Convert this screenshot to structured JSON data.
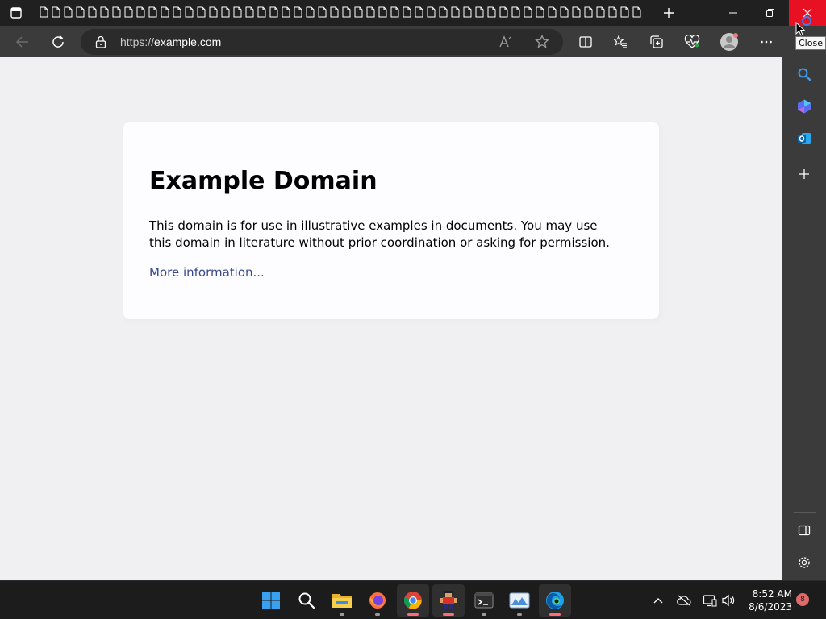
{
  "browser": {
    "tab_count": 50,
    "tooltip": "Close",
    "address": {
      "scheme": "https://",
      "host": "example.com"
    }
  },
  "page": {
    "heading": "Example Domain",
    "description": "This domain is for use in illustrative examples in documents. You may use this domain in literature without prior coordination or asking for permission.",
    "more_link": "More information..."
  },
  "taskbar": {
    "clock_time": "8:52 AM",
    "clock_date": "8/6/2023",
    "notification_count": "8"
  },
  "colors": {
    "titlebar": "#202020",
    "toolbar": "#3b3b3b",
    "page_background": "#f0f0f2",
    "card_background": "#fdfdff",
    "link": "#38488f",
    "close_hover": "#e81123",
    "taskbar": "#1c1c1c"
  },
  "icons": {
    "sidebar": [
      "search-icon",
      "copilot-icon",
      "outlook-icon",
      "add-icon",
      "hide-sidebar-icon",
      "settings-icon"
    ],
    "taskbar": [
      "windows-start-icon",
      "search-icon",
      "file-explorer-icon",
      "firefox-icon",
      "chrome-icon",
      "game-app-icon",
      "terminal-icon",
      "photos-icon",
      "edge-icon"
    ]
  }
}
